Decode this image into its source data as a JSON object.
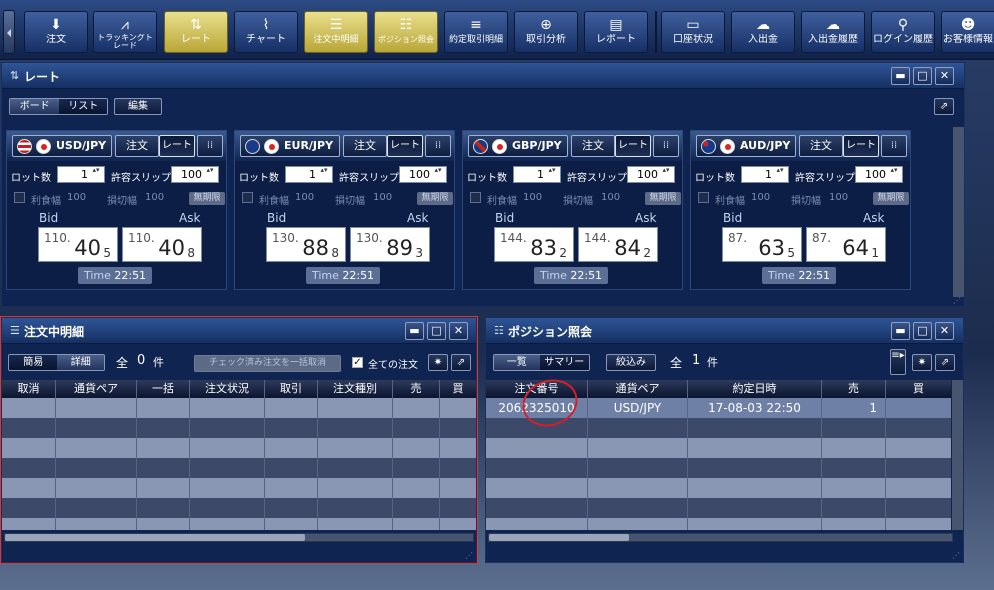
{
  "toolbar": {
    "buttons": [
      {
        "label": "注文",
        "icon": "⬇"
      },
      {
        "label": "トラッキングトレード",
        "icon": "⩘"
      },
      {
        "label": "レート",
        "icon": "⇅"
      },
      {
        "label": "チャート",
        "icon": "⌇"
      },
      {
        "label": "注文中明細",
        "icon": "☰"
      },
      {
        "label": "ポジション照会",
        "icon": "☷"
      },
      {
        "label": "約定取引明細",
        "icon": "≡"
      },
      {
        "label": "取引分析",
        "icon": "⊕"
      },
      {
        "label": "レポート",
        "icon": "▤"
      },
      {
        "label": "口座状況",
        "icon": "▭"
      },
      {
        "label": "入出金",
        "icon": "☁"
      },
      {
        "label": "入出金履歴",
        "icon": "☁"
      },
      {
        "label": "ログイン履歴",
        "icon": "⚲"
      },
      {
        "label": "お客様情報",
        "icon": "☻"
      }
    ]
  },
  "rate_panel": {
    "title": "レート",
    "view_board": "ボード",
    "view_list": "リスト",
    "edit": "編集",
    "labels": {
      "order": "注文",
      "rate": "レート",
      "lot": "ロット数",
      "slip": "許容スリップ",
      "profit": "利食幅",
      "loss": "損切幅",
      "unlimited": "無期限",
      "bid": "Bid",
      "ask": "Ask",
      "time": "Time"
    },
    "cards": [
      {
        "pair": "USD/JPY",
        "lot": "1",
        "slip": "100",
        "profit": "100",
        "loss": "100",
        "bid_big": "110.",
        "bid_main": "40",
        "bid_tail": "5",
        "ask_big": "110.",
        "ask_main": "40",
        "ask_tail": "8",
        "time": "22:51"
      },
      {
        "pair": "EUR/JPY",
        "lot": "1",
        "slip": "100",
        "profit": "100",
        "loss": "100",
        "bid_big": "130.",
        "bid_main": "88",
        "bid_tail": "8",
        "ask_big": "130.",
        "ask_main": "89",
        "ask_tail": "3",
        "time": "22:51"
      },
      {
        "pair": "GBP/JPY",
        "lot": "1",
        "slip": "100",
        "profit": "100",
        "loss": "100",
        "bid_big": "144.",
        "bid_main": "83",
        "bid_tail": "2",
        "ask_big": "144.",
        "ask_main": "84",
        "ask_tail": "2",
        "time": "22:51"
      },
      {
        "pair": "AUD/JPY",
        "lot": "1",
        "slip": "100",
        "profit": "100",
        "loss": "100",
        "bid_big": "87.",
        "bid_main": "63",
        "bid_tail": "5",
        "ask_big": "87.",
        "ask_main": "64",
        "ask_tail": "1",
        "time": "22:51"
      }
    ]
  },
  "order_panel": {
    "title": "注文中明細",
    "view_simple": "簡易",
    "view_detail": "詳細",
    "total_label": "全",
    "count": "0",
    "unit": "件",
    "bulk_cancel": "チェック済み注文を一括取消",
    "all_orders": "全ての注文",
    "columns": [
      "取消",
      "通貨ペア",
      "一括",
      "注文状況",
      "取引",
      "注文種別",
      "売",
      "買"
    ]
  },
  "position_panel": {
    "title": "ポジション照会",
    "view_list": "一覧",
    "view_summary": "サマリー",
    "filter": "絞込み",
    "total_label": "全",
    "count": "1",
    "unit": "件",
    "columns": [
      "注文番号",
      "通貨ペア",
      "約定日時",
      "売",
      "買"
    ],
    "rows": [
      {
        "order_no": "2062325010",
        "pair": "USD/JPY",
        "datetime": "17-08-03 22:50",
        "sell": "1",
        "buy": ""
      }
    ]
  },
  "colors": {
    "annotation": "#d4202a",
    "active_tab": "#e0d37a"
  }
}
